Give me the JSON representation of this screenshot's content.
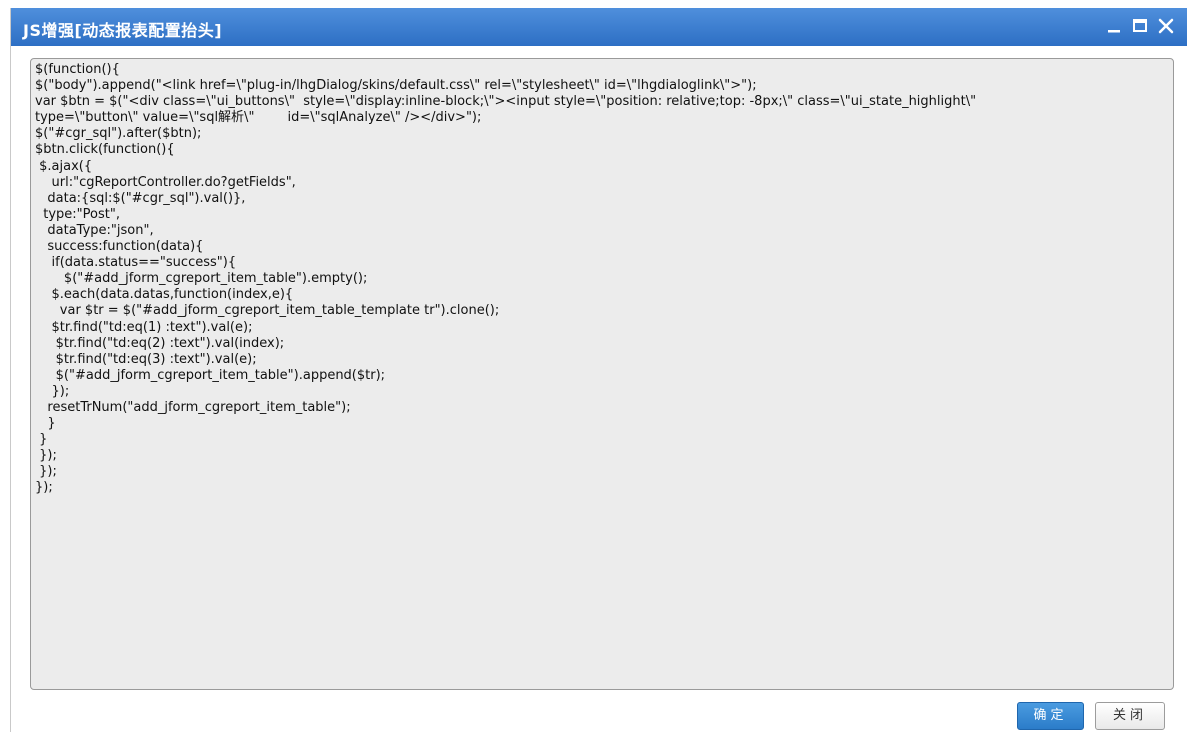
{
  "dialog": {
    "title": "JS增强[动态报表配置抬头]",
    "controls": {
      "minimize_icon": "minimize-icon",
      "maximize_icon": "maximize-icon",
      "close_icon": "close-icon"
    }
  },
  "editor": {
    "content": "$(function(){\n$(\"body\").append(\"<link href=\\\"plug-in/lhgDialog/skins/default.css\\\" rel=\\\"stylesheet\\\" id=\\\"lhgdialoglink\\\">\");\nvar $btn = $(\"<div class=\\\"ui_buttons\\\"  style=\\\"display:inline-block;\\\"><input style=\\\"position: relative;top: -8px;\\\" class=\\\"ui_state_highlight\\\"\ntype=\\\"button\\\" value=\\\"sql解析\\\"        id=\\\"sqlAnalyze\\\" /></div>\");\n$(\"#cgr_sql\").after($btn);\n$btn.click(function(){\n $.ajax({\n    url:\"cgReportController.do?getFields\",\n   data:{sql:$(\"#cgr_sql\").val()},\n  type:\"Post\",\n   dataType:\"json\",\n   success:function(data){\n    if(data.status==\"success\"){\n       $(\"#add_jform_cgreport_item_table\").empty();\n    $.each(data.datas,function(index,e){\n      var $tr = $(\"#add_jform_cgreport_item_table_template tr\").clone();\n    $tr.find(\"td:eq(1) :text\").val(e);\n     $tr.find(\"td:eq(2) :text\").val(index);\n     $tr.find(\"td:eq(3) :text\").val(e);\n     $(\"#add_jform_cgreport_item_table\").append($tr);\n    });\n   resetTrNum(\"add_jform_cgreport_item_table\");\n   }\n }\n });\n });\n});"
  },
  "buttons": {
    "ok_label": "确定",
    "close_label": "关闭"
  },
  "colors": {
    "titlebar": "#3a7fd3",
    "primary_button": "#2f82cf",
    "editor_background": "#ececec"
  }
}
